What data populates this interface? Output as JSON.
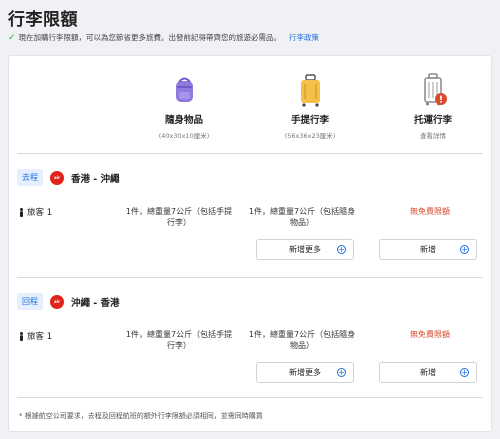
{
  "page": {
    "title": "行李限額",
    "notice": "現在加購行李限額，可以為您節省更多旅費。出發前記得帶齊您的旅遊必需品。",
    "policy_link": "行李政策",
    "check_icon": "check-icon"
  },
  "columns": [
    {
      "name": "隨身物品",
      "sub": "(40x30x10厘米)",
      "icon": "backpack-icon"
    },
    {
      "name": "手提行李",
      "sub": "(56x36x23厘米)",
      "icon": "suitcase-icon"
    },
    {
      "name": "托運行李",
      "sub": "查看詳情",
      "icon": "checked-bag-warning-icon"
    }
  ],
  "segments": [
    {
      "tag": "去程",
      "airline": "AirAsia",
      "route": "香港 - 沖繩",
      "passenger": "旅客 1",
      "personal_item": "1件，總重量7公斤（包括手提行李）",
      "carry_on": "1件，總重量7公斤（包括隨身物品）",
      "checked": "無免費限額",
      "carry_on_button": "新增更多",
      "checked_button": "新增"
    },
    {
      "tag": "回程",
      "airline": "AirAsia",
      "route": "沖繩 - 香港",
      "passenger": "旅客 1",
      "personal_item": "1件，總重量7公斤（包括手提行李）",
      "carry_on": "1件，總重量7公斤（包括隨身物品）",
      "checked": "無免費限額",
      "carry_on_button": "新增更多",
      "checked_button": "新增"
    }
  ],
  "footnote": "* 根據航空公司要求，去程及回程航班的額外行李限額必須相同，並需同時購買",
  "colors": {
    "accent": "#1a6ee0",
    "warning": "#d94a2e",
    "success": "#2aa84a",
    "airline": "#e2231a"
  }
}
